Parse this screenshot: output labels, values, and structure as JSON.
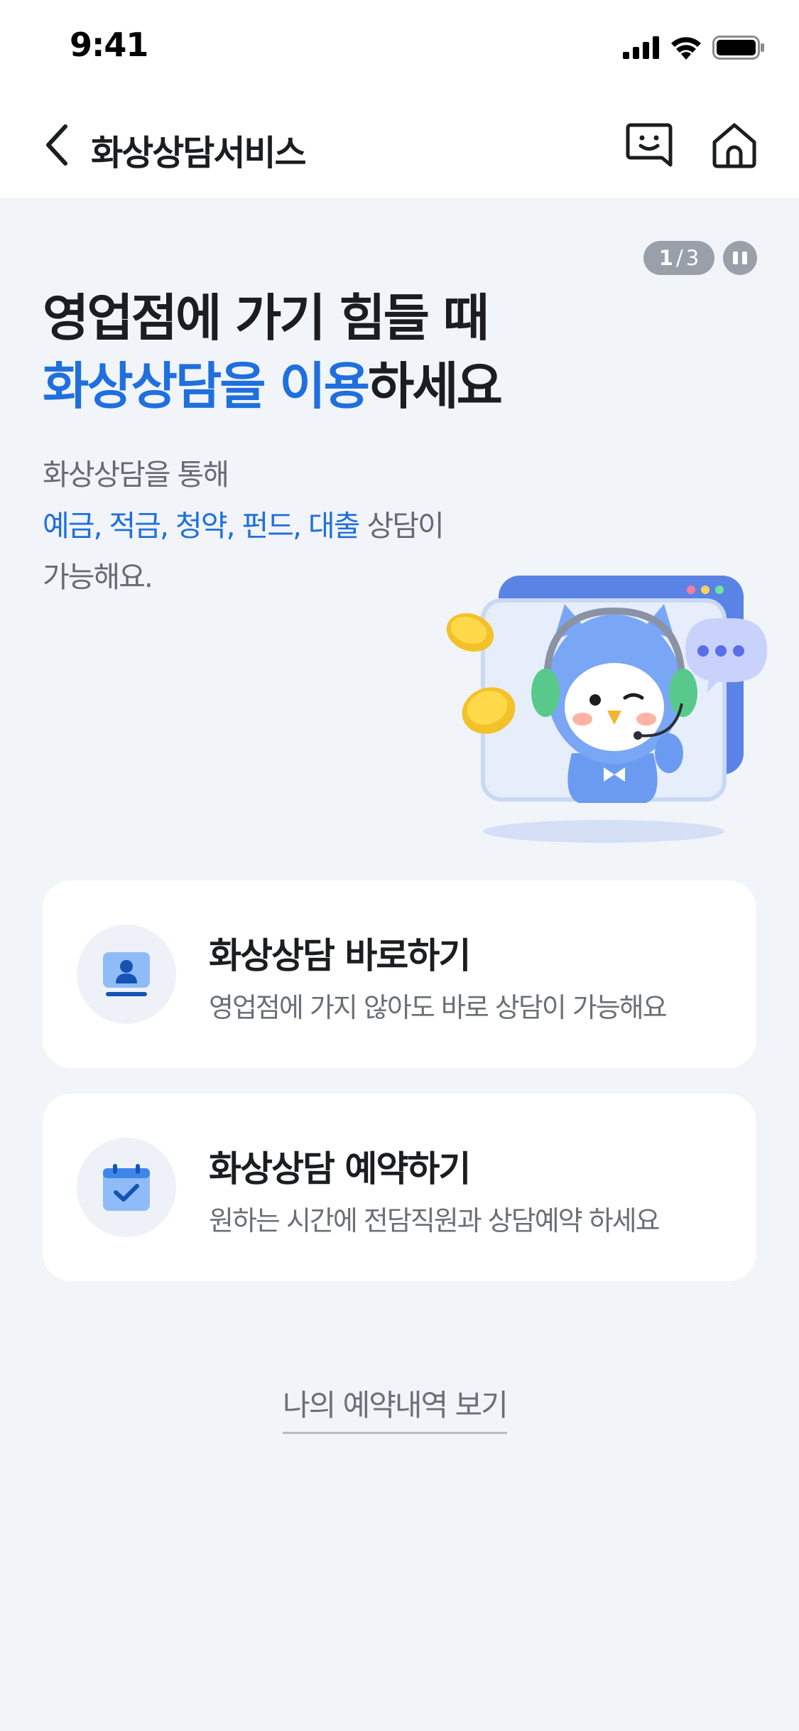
{
  "status_bar": {
    "time": "9:41"
  },
  "nav": {
    "title": "화상상담서비스"
  },
  "slide": {
    "current": "1",
    "separator": "/",
    "total": "3"
  },
  "hero": {
    "title_line1": "영업점에 가기 힘들 때",
    "title_line2_highlight": "화상상담을 이용",
    "title_line2_rest": "하세요",
    "desc_line1": "화상상담을 통해",
    "desc_line2_highlight": "예금, 적금, 청약, 펀드, 대출",
    "desc_line2_rest": " 상담이",
    "desc_line3": "가능해요."
  },
  "cards": [
    {
      "title": "화상상담 바로하기",
      "desc": "영업점에 가지 않아도 바로 상담이 가능해요",
      "icon": "counselor-icon"
    },
    {
      "title": "화상상담 예약하기",
      "desc": "원하는 시간에 전담직원과 상담예약 하세요",
      "icon": "calendar-check-icon"
    }
  ],
  "footer_link": {
    "label": "나의 예약내역 보기"
  },
  "colors": {
    "accent": "#1f6fde",
    "background": "#f1f4f9",
    "card": "#ffffff",
    "text_primary": "#1b1d21",
    "text_secondary": "#6b6f76"
  }
}
